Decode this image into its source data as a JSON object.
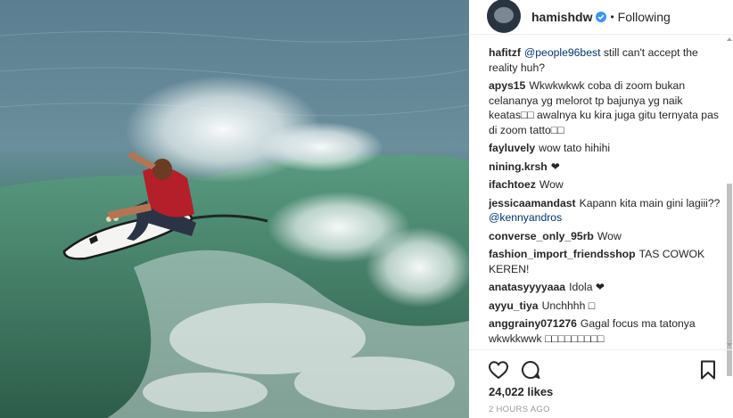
{
  "header": {
    "username": "hamishdw",
    "separator": "•",
    "follow_label": "Following"
  },
  "comments": [
    {
      "user": "hafitzf",
      "segments": [
        {
          "mention": "@people96best"
        },
        {
          "text": " still can't accept the reality huh?"
        }
      ]
    },
    {
      "user": "apys15",
      "segments": [
        {
          "text": "Wkwkwkwk coba di zoom bukan celananya yg melorot tp bajunya yg naik keatas□□ awalnya ku kira juga gitu ternyata pas di zoom tatto□□"
        }
      ]
    },
    {
      "user": "fayluvely",
      "segments": [
        {
          "text": "wow tato hihihi"
        }
      ]
    },
    {
      "user": "nining.krsh",
      "segments": [
        {
          "text": "❤"
        }
      ]
    },
    {
      "user": "ifachtoez",
      "segments": [
        {
          "text": "Wow"
        }
      ]
    },
    {
      "user": "jessicaamandast",
      "segments": [
        {
          "text": "Kapann kita main gini lagiii?? "
        },
        {
          "mention": "@kennyandros"
        }
      ]
    },
    {
      "user": "converse_only_95rb",
      "segments": [
        {
          "text": "Wow"
        }
      ]
    },
    {
      "user": "fashion_import_friendsshop",
      "segments": [
        {
          "text": "TAS COWOK KEREN!"
        }
      ]
    },
    {
      "user": "anatasyyyyaaa",
      "segments": [
        {
          "text": "Idola ❤"
        }
      ]
    },
    {
      "user": "ayyu_tiya",
      "segments": [
        {
          "text": "Unchhhh □"
        }
      ]
    },
    {
      "user": "anggrainy071276",
      "segments": [
        {
          "text": "Gagal focus ma tatonya wkwkkwwk □□□□□□□□□"
        }
      ]
    }
  ],
  "actions": {
    "like_icon": "heart-outline-icon",
    "comment_icon": "speech-bubble-icon",
    "save_icon": "bookmark-icon"
  },
  "likes_text": "24,022 likes",
  "timestamp": "2 HOURS AGO",
  "colors": {
    "mention": "#003569",
    "username": "#262626",
    "muted": "#999999",
    "verified": "#3897f0",
    "divider": "#efefef"
  }
}
